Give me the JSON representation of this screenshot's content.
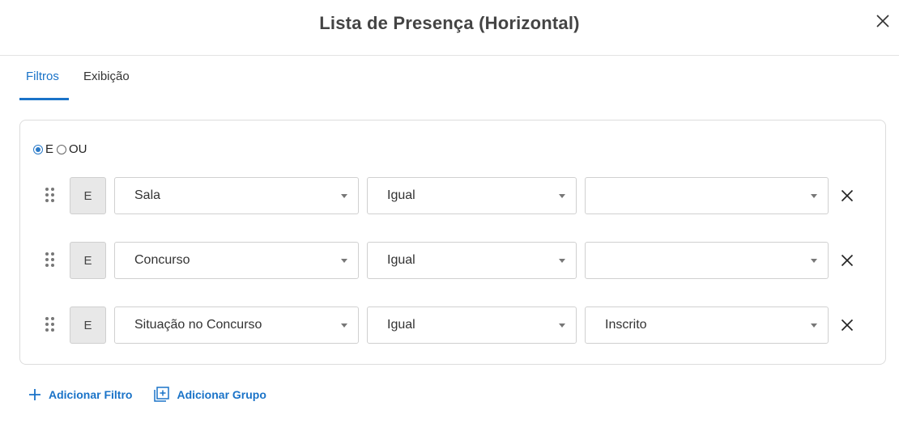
{
  "dialog": {
    "title": "Lista de Presença (Horizontal)",
    "close_icon": "close-icon"
  },
  "tabs": [
    {
      "label": "Filtros",
      "active": true
    },
    {
      "label": "Exibição",
      "active": false
    }
  ],
  "logic": {
    "options": [
      {
        "label": "E",
        "checked": true
      },
      {
        "label": "OU",
        "checked": false
      }
    ]
  },
  "filters": [
    {
      "connector": "E",
      "field": "Sala",
      "operator": "Igual",
      "value": ""
    },
    {
      "connector": "E",
      "field": "Concurso",
      "operator": "Igual",
      "value": ""
    },
    {
      "connector": "E",
      "field": "Situação no Concurso",
      "operator": "Igual",
      "value": "Inscrito"
    }
  ],
  "actions": {
    "add_filter": "Adicionar Filtro",
    "add_group": "Adicionar Grupo"
  },
  "colors": {
    "accent": "#1a73c8",
    "radio_checked": "#2a7ac8"
  }
}
